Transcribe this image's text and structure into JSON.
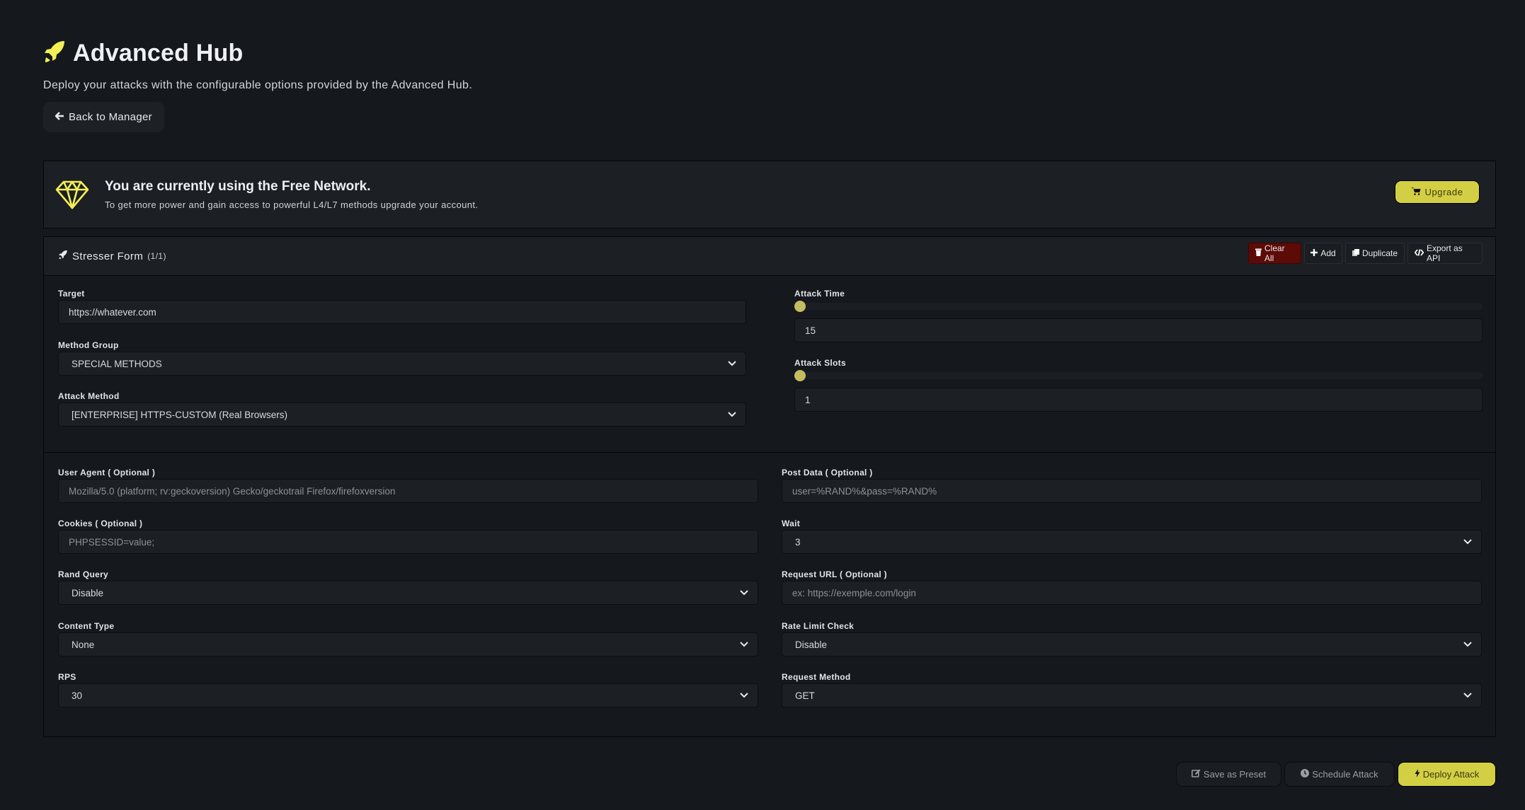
{
  "header": {
    "title": "Advanced Hub",
    "subtitle": "Deploy your attacks with the configurable options provided by the Advanced Hub.",
    "back_label": "Back to Manager"
  },
  "notice": {
    "title": "You are currently using the Free Network.",
    "description": "To get more power and gain access to powerful L4/L7 methods upgrade your account.",
    "upgrade_label": "Upgrade"
  },
  "form": {
    "title": "Stresser Form",
    "count": "(1/1)",
    "actions": {
      "clear_all": "Clear All",
      "add": "Add",
      "duplicate": "Duplicate",
      "export_api": "Export as API"
    },
    "target": {
      "label": "Target",
      "value": "https://whatever.com"
    },
    "method_group": {
      "label": "Method Group",
      "value": "SPECIAL METHODS"
    },
    "attack_method": {
      "label": "Attack Method",
      "value": "[ENTERPRISE] HTTPS-CUSTOM (Real Browsers)"
    },
    "attack_time": {
      "label": "Attack Time",
      "value": "15",
      "slider_fraction": 0
    },
    "attack_slots": {
      "label": "Attack Slots",
      "value": "1",
      "slider_fraction": 0
    },
    "user_agent": {
      "label": "User Agent ( Optional )",
      "placeholder": "Mozilla/5.0 (platform; rv:geckoversion) Gecko/geckotrail Firefox/firefoxversion"
    },
    "cookies": {
      "label": "Cookies ( Optional )",
      "placeholder": "PHPSESSID=value;"
    },
    "rand_query": {
      "label": "Rand Query",
      "value": "Disable"
    },
    "content_type": {
      "label": "Content Type",
      "value": "None"
    },
    "rps": {
      "label": "RPS",
      "value": "30"
    },
    "post_data": {
      "label": "Post Data ( Optional )",
      "placeholder": "user=%RAND%&pass=%RAND%"
    },
    "wait": {
      "label": "Wait",
      "value": "3"
    },
    "request_url": {
      "label": "Request URL ( Optional )",
      "placeholder": "ex: https://exemple.com/login"
    },
    "rate_limit_check": {
      "label": "Rate Limit Check",
      "value": "Disable"
    },
    "request_method": {
      "label": "Request Method",
      "value": "GET"
    }
  },
  "footer": {
    "save_preset": "Save as Preset",
    "schedule": "Schedule Attack",
    "deploy": "Deploy Attack"
  },
  "colors": {
    "accent": "#d3cf45",
    "danger": "#5c0b06",
    "background": "#15181d",
    "card": "#1c1f24"
  }
}
